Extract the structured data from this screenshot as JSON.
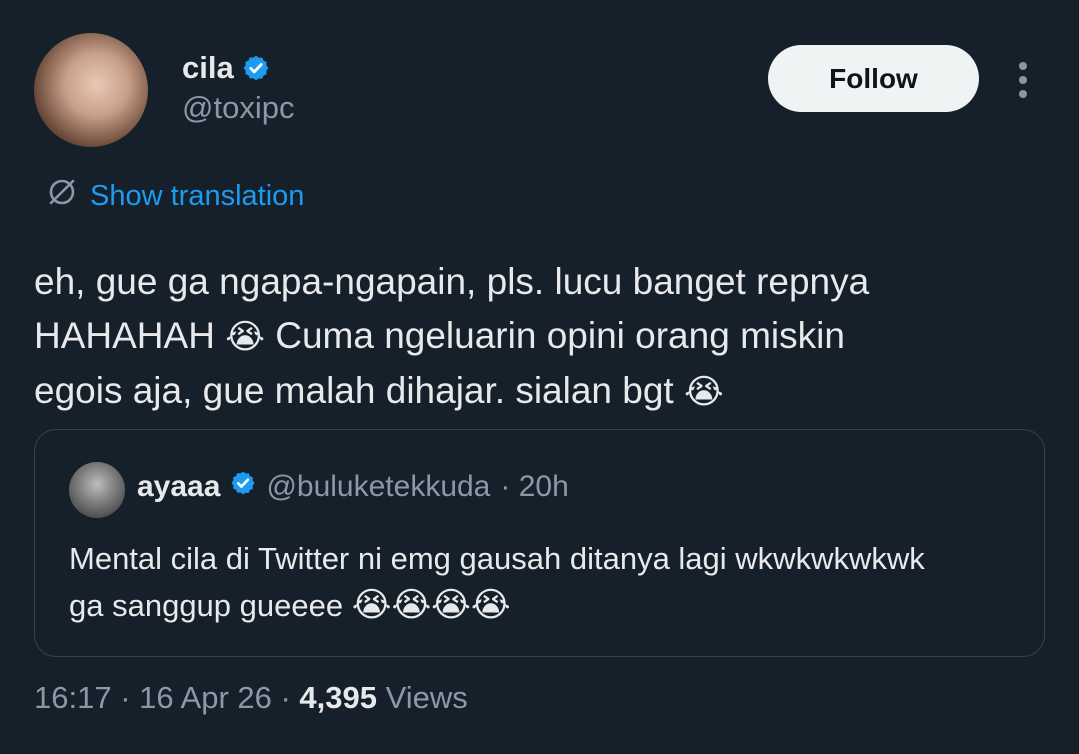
{
  "author": {
    "name": "cila",
    "handle": "@toxipc",
    "avatar_icon": "profile-photo",
    "verified_color": "#1d9bf0"
  },
  "actions": {
    "follow_label": "Follow",
    "more_icon": "more-horizontal-icon"
  },
  "translation": {
    "label": "Show translation",
    "icon": "translate-icon"
  },
  "tweet": {
    "line1": "eh, gue ga ngapa-ngapain, pls. lucu banget repnya",
    "line2_a": "HAHAHAH ",
    "emoji1": "😭",
    "line2_b": " Cuma ngeluarin opini orang miskin",
    "line3": "egois aja, gue malah dihajar. sialan bgt ",
    "emoji2": "😭"
  },
  "quote": {
    "name": "ayaaa",
    "handle": "@buluketekkuda",
    "time": "· 20h",
    "line1": "Mental cila di Twitter ni emg gausah ditanya lagi wkwkwkwkwk",
    "line2": "ga sanggup gueeee ",
    "emojis": "😭😭😭😭"
  },
  "meta": {
    "time": "16:17",
    "sep1": " · ",
    "date": "16 Apr 26",
    "sep2": " · ",
    "views_count": "4,395",
    "views_label": " Views"
  },
  "colors": {
    "background": "#15202b",
    "accent": "#1d9bf0",
    "secondary_text": "#8b98a5"
  }
}
